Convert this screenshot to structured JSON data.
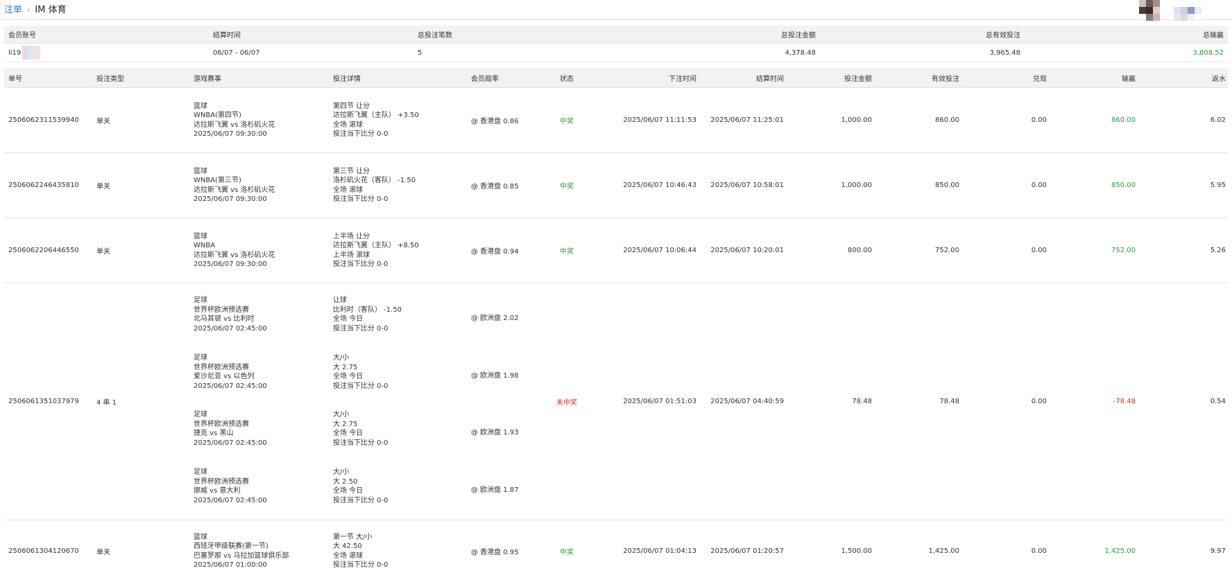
{
  "breadcrumb": {
    "root": "注单",
    "separator": "›",
    "current": "IM 体育"
  },
  "summary": {
    "headers": [
      "会员账号",
      "结算时间",
      "总投注笔数",
      "总投注金额",
      "总有效投注",
      "总输赢"
    ],
    "values": {
      "account": "li19",
      "settle_period": "06/07 - 06/07",
      "bet_count": "5",
      "total_bet": "4,378.48",
      "total_valid": "3,965.48",
      "total_winloss": "3,808.52"
    }
  },
  "table": {
    "headers": [
      "单号",
      "投注类型",
      "游戏赛事",
      "投注详情",
      "会员赔率",
      "状态",
      "下注时间",
      "结算时间",
      "投注金额",
      "有效投注",
      "兑现",
      "输赢",
      "返水"
    ],
    "rows": [
      {
        "id": "2506062311539940",
        "type": "单关",
        "legs": [
          {
            "event": [
              "篮球",
              "WNBA(第四节)",
              "达拉斯飞翼 vs 洛杉矶火花",
              "2025/06/07 09:30:00"
            ],
            "detail": [
              "第四节 让分",
              "达拉斯飞翼（主队） +3.50",
              "全场 滚球",
              "投注当下比分 0-0"
            ],
            "odds": "@ 香港盘 0.86"
          }
        ],
        "status": "中奖",
        "bet_time": "2025/06/07 11:11:53",
        "settle_time": "2025/06/07 11:25:01",
        "amount": "1,000.00",
        "valid": "860.00",
        "cashout": "0.00",
        "winloss": "860.00",
        "rebate": "6.02"
      },
      {
        "id": "2506062246435810",
        "type": "单关",
        "legs": [
          {
            "event": [
              "篮球",
              "WNBA(第三节)",
              "达拉斯飞翼 vs 洛杉矶火花",
              "2025/06/07 09:30:00"
            ],
            "detail": [
              "第三节 让分",
              "洛杉矶火花（客队） -1.50",
              "全场 滚球",
              "投注当下比分 0-0"
            ],
            "odds": "@ 香港盘 0.85"
          }
        ],
        "status": "中奖",
        "bet_time": "2025/06/07 10:46:43",
        "settle_time": "2025/06/07 10:58:01",
        "amount": "1,000.00",
        "valid": "850.00",
        "cashout": "0.00",
        "winloss": "850.00",
        "rebate": "5.95"
      },
      {
        "id": "2506062206446550",
        "type": "单关",
        "legs": [
          {
            "event": [
              "篮球",
              "WNBA",
              "达拉斯飞翼 vs 洛杉矶火花",
              "2025/06/07 09:30:00"
            ],
            "detail": [
              "上半场 让分",
              "达拉斯飞翼（主队） +8.50",
              "上半场 滚球",
              "投注当下比分 0-0"
            ],
            "odds": "@ 香港盘 0.94"
          }
        ],
        "status": "中奖",
        "bet_time": "2025/06/07 10:06:44",
        "settle_time": "2025/06/07 10:20:01",
        "amount": "800.00",
        "valid": "752.00",
        "cashout": "0.00",
        "winloss": "752.00",
        "rebate": "5.26"
      },
      {
        "id": "2506061351037979",
        "type": "4 串 1",
        "legs": [
          {
            "event": [
              "足球",
              "世界杯欧洲预选赛",
              "北马其顿 vs 比利时",
              "2025/06/07 02:45:00"
            ],
            "detail": [
              "让球",
              "比利时（客队） -1.50",
              "全场 今日",
              "投注当下比分 0-0"
            ],
            "odds": "@ 欧洲盘 2.02"
          },
          {
            "event": [
              "足球",
              "世界杯欧洲预选赛",
              "爱沙尼亚 vs 以色列",
              "2025/06/07 02:45:00"
            ],
            "detail": [
              "大/小",
              "大 2.75",
              "全场 今日",
              "投注当下比分 0-0"
            ],
            "odds": "@ 欧洲盘 1.98"
          },
          {
            "event": [
              "足球",
              "世界杯欧洲预选赛",
              "捷克 vs 黑山",
              "2025/06/07 02:45:00"
            ],
            "detail": [
              "大/小",
              "大 2.75",
              "全场 今日",
              "投注当下比分 0-0"
            ],
            "odds": "@ 欧洲盘 1.93"
          },
          {
            "event": [
              "足球",
              "世界杯欧洲预选赛",
              "挪威 vs 意大利",
              "2025/06/07 02:45:00"
            ],
            "detail": [
              "大/小",
              "大 2.50",
              "全场 今日",
              "投注当下比分 0-0"
            ],
            "odds": "@ 欧洲盘 1.87"
          }
        ],
        "status": "未中奖",
        "bet_time": "2025/06/07 01:51:03",
        "settle_time": "2025/06/07 04:40:59",
        "amount": "78.48",
        "valid": "78.48",
        "cashout": "0.00",
        "winloss": "-78.48",
        "rebate": "0.54"
      },
      {
        "id": "2506061304120670",
        "type": "单关",
        "legs": [
          {
            "event": [
              "篮球",
              "西班牙甲级联赛(第一节)",
              "巴塞罗那 vs 马拉加篮球俱乐部",
              "2025/06/07 01:00:00"
            ],
            "detail": [
              "第一节 大/小",
              "大 42.50",
              "全场 滚球",
              "投注当下比分 0-0"
            ],
            "odds": "@ 香港盘 0.95"
          }
        ],
        "status": "中奖",
        "bet_time": "2025/06/07 01:04:13",
        "settle_time": "2025/06/07 01:20:57",
        "amount": "1,500.00",
        "valid": "1,425.00",
        "cashout": "0.00",
        "winloss": "1,425.00",
        "rebate": "9.97"
      }
    ]
  },
  "colors": {
    "link": "#2d7cd6",
    "win": "#2e9a42",
    "loss": "#d93025",
    "header_bg": "#f2f2f2"
  }
}
